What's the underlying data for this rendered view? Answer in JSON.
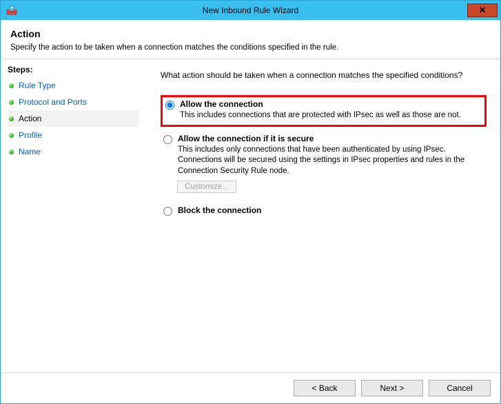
{
  "window": {
    "title": "New Inbound Rule Wizard"
  },
  "header": {
    "title": "Action",
    "subtitle": "Specify the action to be taken when a connection matches the conditions specified in the rule."
  },
  "sidebar": {
    "heading": "Steps:",
    "items": [
      {
        "label": "Rule Type",
        "active": false
      },
      {
        "label": "Protocol and Ports",
        "active": false
      },
      {
        "label": "Action",
        "active": true
      },
      {
        "label": "Profile",
        "active": false
      },
      {
        "label": "Name",
        "active": false
      }
    ]
  },
  "content": {
    "prompt": "What action should be taken when a connection matches the specified conditions?",
    "options": [
      {
        "id": "allow",
        "title": "Allow the connection",
        "desc": "This includes connections that are protected with IPsec as well as those are not.",
        "selected": true,
        "highlighted": true
      },
      {
        "id": "allow-secure",
        "title": "Allow the connection if it is secure",
        "desc": "This includes only connections that have been authenticated by using IPsec. Connections will be secured using the settings in IPsec properties and rules in the Connection Security Rule node.",
        "selected": false,
        "customize_label": "Customize..."
      },
      {
        "id": "block",
        "title": "Block the connection",
        "desc": "",
        "selected": false
      }
    ]
  },
  "footer": {
    "back": "< Back",
    "next": "Next >",
    "cancel": "Cancel"
  }
}
